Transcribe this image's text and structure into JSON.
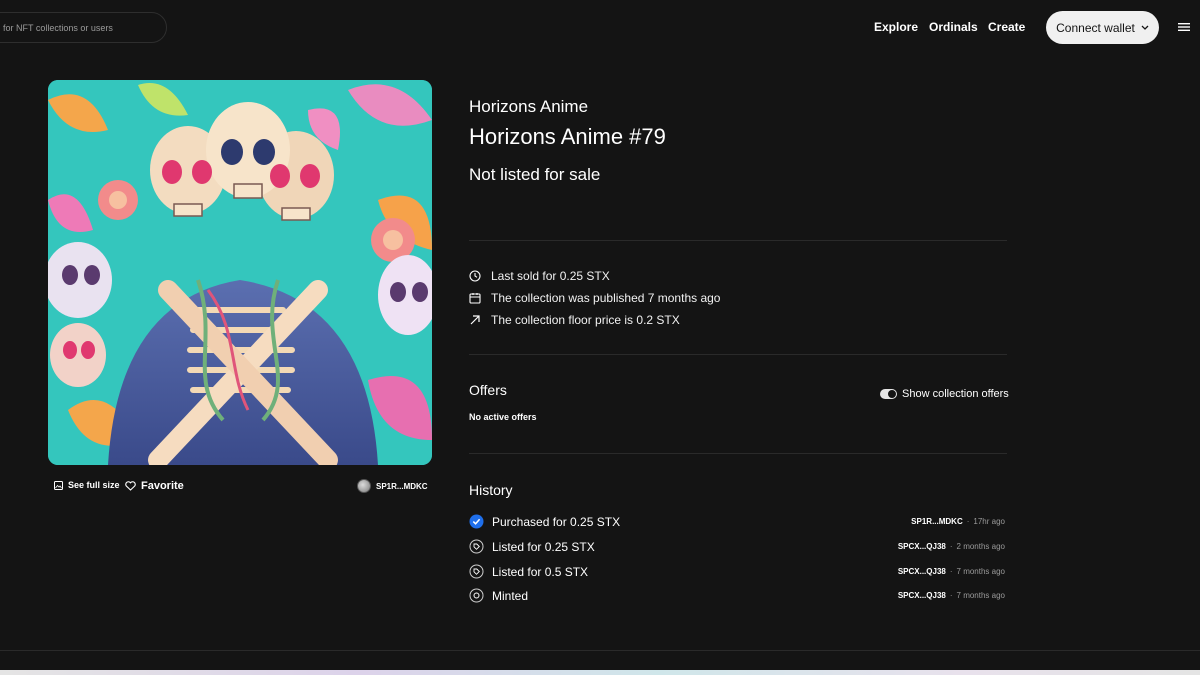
{
  "header": {
    "search_placeholder": "for NFT collections or users",
    "nav": [
      "Explore",
      "Ordinals",
      "Create"
    ],
    "connect_label": "Connect wallet"
  },
  "item": {
    "collection": "Horizons Anime",
    "title": "Horizons Anime #79",
    "sale_status": "Not listed for sale"
  },
  "image_actions": {
    "full_size": "See full size",
    "favorite": "Favorite",
    "owner": "SP1R...MDKC"
  },
  "facts": [
    {
      "icon": "clock-icon",
      "text": "Last sold for 0.25 STX"
    },
    {
      "icon": "calendar-icon",
      "text": "The collection was published 7 months ago"
    },
    {
      "icon": "arrow-up-right-icon",
      "text": "The collection floor price is 0.2 STX"
    }
  ],
  "offers": {
    "title": "Offers",
    "empty": "No active offers",
    "toggle_label": "Show collection offers",
    "toggle_on": true
  },
  "history": {
    "title": "History",
    "rows": [
      {
        "icon": "check-badge-icon",
        "label": "Purchased for 0.25 STX",
        "address": "SP1R...MDKC",
        "sep": "·",
        "time": "17hr ago"
      },
      {
        "icon": "tag-icon",
        "label": "Listed for 0.25 STX",
        "address": "SPCX...QJ38",
        "sep": "·",
        "time": "2 months ago"
      },
      {
        "icon": "tag-icon",
        "label": "Listed for 0.5 STX",
        "address": "SPCX...QJ38",
        "sep": "·",
        "time": "7 months ago"
      },
      {
        "icon": "mint-icon",
        "label": "Minted",
        "address": "SPCX...QJ38",
        "sep": "·",
        "time": "7 months ago"
      }
    ]
  },
  "colors": {
    "background": "#141414",
    "accent_blue": "#1f6feb",
    "muted_text": "#9a9a9a"
  }
}
